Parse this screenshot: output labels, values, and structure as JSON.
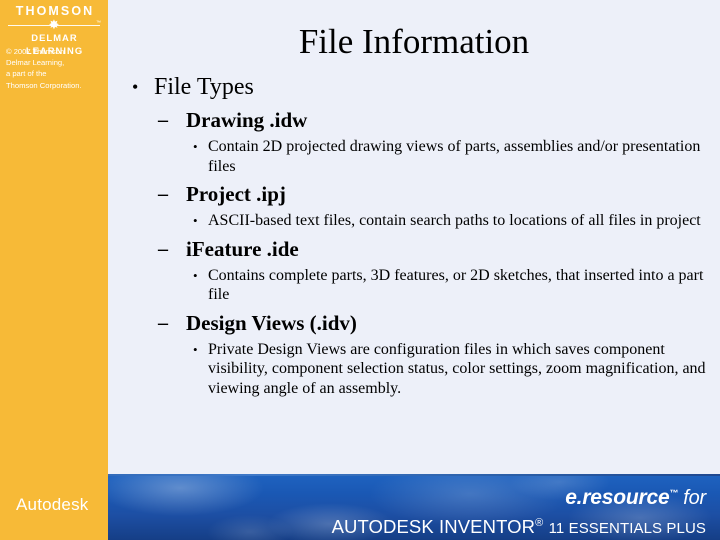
{
  "sidebar": {
    "logo": {
      "brand_top": "THOMSON",
      "brand_bottom": "DELMAR LEARNING",
      "star_glyph": "✸",
      "tm_glyph": "™"
    },
    "copyright": [
      "© 2007 Thomson",
      "Delmar Learning,",
      "a part of the",
      "Thomson Corporation."
    ],
    "wordmark": "Autodesk"
  },
  "slide": {
    "title": "File Information",
    "bullet_glyph": "•",
    "dash_glyph": "–",
    "items": [
      {
        "level": 1,
        "text": "File Types"
      },
      {
        "level": 2,
        "text": "Drawing .idw"
      },
      {
        "level": 3,
        "text": "Contain 2D projected drawing views of parts, assemblies and/or presentation files"
      },
      {
        "level": 2,
        "text": "Project .ipj"
      },
      {
        "level": 3,
        "text": "ASCII-based text files, contain search paths to locations of all files in project"
      },
      {
        "level": 2,
        "text": "iFeature .ide"
      },
      {
        "level": 3,
        "text": "Contains complete parts, 3D features, or 2D sketches, that inserted into a part file"
      },
      {
        "level": 2,
        "text": "Design Views (.idv)"
      },
      {
        "level": 3,
        "text": "Private Design Views are configuration files in which saves component visibility, component selection status, color settings, zoom magnification, and viewing angle of an assembly."
      }
    ]
  },
  "footer": {
    "brand_eresource": "e.resource",
    "brand_tm": "™",
    "brand_for": "for",
    "brand_product_pre": "AUTODESK INVENTOR",
    "brand_reg": "®",
    "brand_product_post": "11 ESSENTIALS PLUS"
  },
  "colors": {
    "sidebar_orange": "#f7ba37",
    "page_background": "#edf0f9",
    "footer_blue": "#1a58b4",
    "text_black": "#000000",
    "logo_white": "#ffffff"
  }
}
